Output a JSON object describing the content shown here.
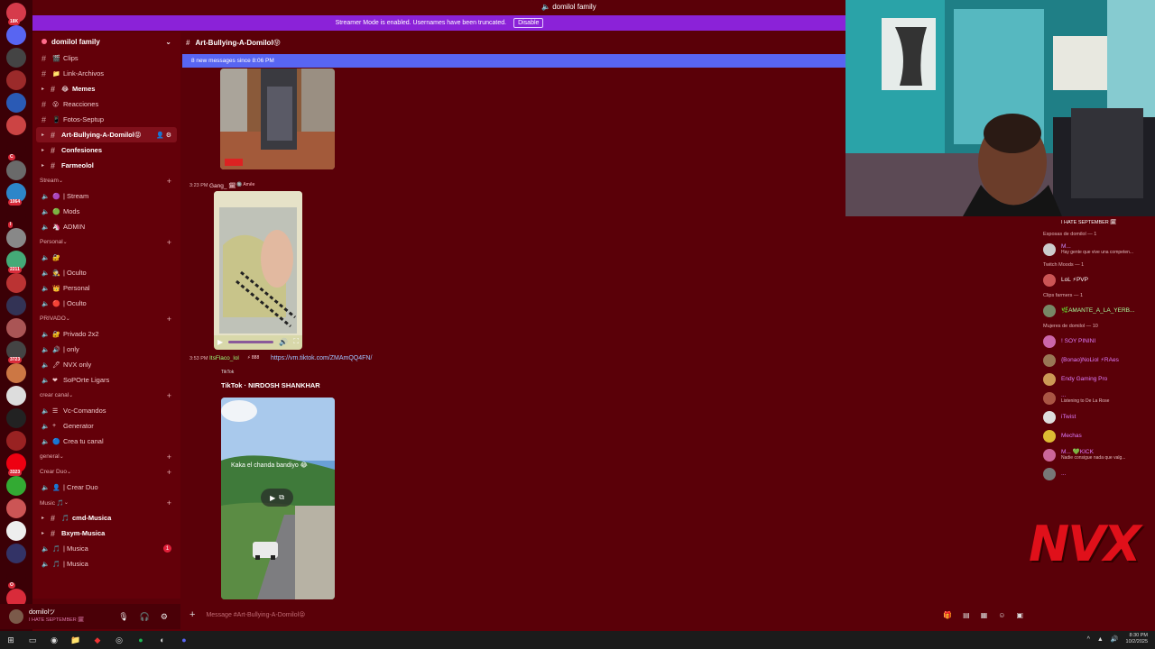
{
  "window_title": "domilol family",
  "streamer_banner": {
    "text": "Streamer Mode is enabled. Usernames have been truncated.",
    "disable_label": "Disable"
  },
  "server": {
    "name": "domilol family"
  },
  "rail": {
    "items": [
      {
        "badge": "18K",
        "color": "#d63b4b"
      },
      {
        "badge": "",
        "color": "#5865f2"
      },
      {
        "badge": "",
        "color": "#444"
      },
      {
        "badge": "",
        "color": "#9b2a2a"
      },
      {
        "badge": "",
        "color": "#2a5ab5"
      },
      {
        "badge": "",
        "color": "#c44"
      },
      {
        "badge": "C",
        "color": "#3b0006"
      },
      {
        "badge": "",
        "color": "#6a6a6a"
      },
      {
        "badge": "1064",
        "color": "#2d86c9"
      },
      {
        "badge": "I",
        "color": "#3b0006"
      },
      {
        "badge": "",
        "color": "#888"
      },
      {
        "badge": "2211",
        "color": "#4a7"
      },
      {
        "badge": "",
        "color": "#b33"
      },
      {
        "badge": "",
        "color": "#335"
      },
      {
        "badge": "",
        "color": "#a55"
      },
      {
        "badge": "3723",
        "color": "#444"
      },
      {
        "badge": "",
        "color": "#c74"
      },
      {
        "badge": "",
        "color": "#ddd"
      },
      {
        "badge": "",
        "color": "#222"
      },
      {
        "badge": "",
        "color": "#922"
      },
      {
        "badge": "3323",
        "color": "#e01"
      },
      {
        "badge": "",
        "color": "#3a3"
      },
      {
        "badge": "",
        "color": "#c55"
      },
      {
        "badge": "",
        "color": "#eee"
      },
      {
        "badge": "",
        "color": "#336"
      },
      {
        "badge": "O",
        "color": "#3b0006"
      },
      {
        "badge": "NEW",
        "color": "#d92b3a"
      }
    ]
  },
  "sidebar": {
    "channels_top": [
      {
        "emoji": "🎬",
        "label": "Clips",
        "style": "normal"
      },
      {
        "emoji": "📁",
        "label": "Link-Archivos",
        "style": "normal"
      },
      {
        "emoji": "😂",
        "label": "Memes",
        "style": "bold"
      },
      {
        "emoji": "😮",
        "label": "Reacciones",
        "style": "normal"
      },
      {
        "emoji": "📱",
        "label": "Fotos-Septup",
        "style": "normal"
      },
      {
        "emoji": "",
        "label": "Art-Bullying-A-Domilol😝",
        "style": "active"
      },
      {
        "emoji": "",
        "label": "Confesiones",
        "style": "bold"
      },
      {
        "emoji": "",
        "label": "Farmeolol",
        "style": "bold"
      }
    ],
    "categories": [
      {
        "name": "Stream",
        "channels": [
          {
            "emoji": "🟣",
            "label": "| Stream"
          },
          {
            "emoji": "🟢",
            "label": "Mods"
          },
          {
            "emoji": "🦄",
            "label": "ADMIN"
          }
        ]
      },
      {
        "name": "Personal",
        "channels": [
          {
            "emoji": "🔐",
            "label": ""
          },
          {
            "emoji": "🕵",
            "label": "| Oculto"
          },
          {
            "emoji": "👑",
            "label": "Personal"
          },
          {
            "emoji": "🔴",
            "label": "| Oculto"
          }
        ]
      },
      {
        "name": "PRIVADO",
        "channels": [
          {
            "emoji": "🔐",
            "label": "Privado 2x2"
          },
          {
            "emoji": "🔊",
            "label": "| only"
          },
          {
            "emoji": "🖊",
            "label": "NVX only"
          },
          {
            "emoji": "❤",
            "label": "SoPOrte Ligars"
          }
        ]
      },
      {
        "name": "crear canal",
        "channels": [
          {
            "emoji": "☰",
            "label": "Vc-Comandos"
          },
          {
            "emoji": "+",
            "label": "Generator"
          },
          {
            "emoji": "🔵",
            "label": "Crea tu canal"
          }
        ]
      },
      {
        "name": "general",
        "channels": []
      },
      {
        "name": "Crear Duo",
        "channels": [
          {
            "emoji": "👤",
            "label": "| Crear Duo"
          }
        ]
      },
      {
        "name": "Music 🎵",
        "channels": [
          {
            "emoji": "🎵",
            "label": "cmd-Musica",
            "text": true
          },
          {
            "emoji": "",
            "label": "Bxym-Musica",
            "text": true
          },
          {
            "emoji": "🎵",
            "label": "| Musica",
            "count": "1"
          },
          {
            "emoji": "🎵",
            "label": "| Musica"
          }
        ]
      }
    ]
  },
  "user": {
    "name": "domilolツ",
    "status": "I HATE SEPTEMBER 🗓"
  },
  "chat": {
    "channel": "Art-Bullying-A-Domilol😝",
    "new_messages": "8 new messages since 8:06 PM",
    "msg1": {
      "time": "3:23 PM",
      "author": "Gang_ 🗓",
      "tag": "🔘 Amêe"
    },
    "msg2": {
      "time": "3:53 PM",
      "author": "ItsFlaco_lol",
      "tag": "⚡ 888",
      "link": "https://vm.tiktok.com/ZMAmQQ4FN/"
    },
    "embed": {
      "provider": "TikTok",
      "title": "TikTok · NIRDOSH SHANKHAR",
      "overlay": "Kaka el chanda bandiyo 😂"
    },
    "composer_placeholder": "Message #Art-Bullying-A-Domilol😝"
  },
  "members": {
    "top_status": "I HATE SEPTEMBER 🗓",
    "groups": [
      {
        "title": "Esposas de domilol — 1",
        "members": [
          {
            "name": "M...",
            "status": "Hay gente que vive una competen...",
            "color": "#c98aff",
            "av": "#ccc"
          }
        ]
      },
      {
        "title": "Twitch Moods — 1",
        "members": [
          {
            "name": "LoL ⚡PVP",
            "status": "",
            "color": "#fff",
            "av": "#c55"
          }
        ]
      },
      {
        "title": "Clips farmers — 1",
        "members": [
          {
            "name": "🌿AMANTE_A_LA_YERB...",
            "status": "",
            "color": "#a8ff9e",
            "av": "#786"
          }
        ]
      },
      {
        "title": "Mujeres de domilol — 10",
        "members": [
          {
            "name": "! SOY PININI",
            "status": "",
            "color": "#e07aff",
            "av": "#c6a"
          },
          {
            "name": "{Bonao}NoLiol ⚡RAes",
            "status": "",
            "color": "#e07aff",
            "av": "#975"
          },
          {
            "name": "Endy Gaming Pro",
            "status": "",
            "color": "#e07aff",
            "av": "#c95"
          },
          {
            "name": "...",
            "status": "Listening to De La Rose",
            "color": "#e07aff",
            "av": "#a54"
          },
          {
            "name": "iTwist",
            "status": "",
            "color": "#e07aff",
            "av": "#ddd"
          },
          {
            "name": "Mechas",
            "status": "",
            "color": "#e07aff",
            "av": "#db3"
          },
          {
            "name": "M... 💚KICK",
            "status": "Nadie consigue nada que valg...",
            "color": "#e07aff",
            "av": "#c69"
          },
          {
            "name": "...",
            "status": "",
            "color": "#e07aff",
            "av": "#777"
          }
        ]
      }
    ]
  },
  "brand_logo": "NVX",
  "taskbar": {
    "time": "8:30 PM",
    "date": "10/2/2025"
  },
  "colors": {
    "bg": "#5a0008",
    "sidebar": "#630009",
    "banner": "#8b22d8",
    "new_msgs": "#5865f2",
    "logo": "#e0101a"
  }
}
